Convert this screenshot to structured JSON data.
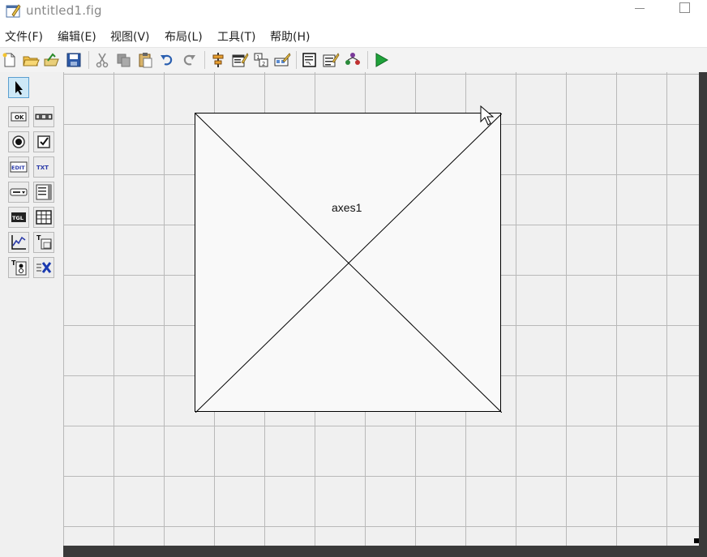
{
  "window": {
    "title": "untitled1.fig"
  },
  "menubar": {
    "items": [
      "文件(F)",
      "编辑(E)",
      "视图(V)",
      "布局(L)",
      "工具(T)",
      "帮助(H)"
    ]
  },
  "toolbar": {
    "buttons": [
      "new-file",
      "open-file",
      "open-figure",
      "save",
      "cut",
      "copy",
      "paste",
      "undo",
      "redo",
      "align-objects",
      "menu-editor",
      "tab-order-editor",
      "toolbar-editor",
      "m-file-editor",
      "property-inspector",
      "object-browser",
      "run-figure"
    ]
  },
  "palette": {
    "tools": [
      "select",
      "push-button",
      "slider",
      "radio-button",
      "check-box",
      "edit-text",
      "static-text",
      "popup-menu",
      "listbox",
      "toggle-button",
      "table",
      "axes",
      "panel",
      "button-group",
      "activex-control"
    ],
    "selected": "select"
  },
  "canvas": {
    "axes_label": "axes1"
  }
}
